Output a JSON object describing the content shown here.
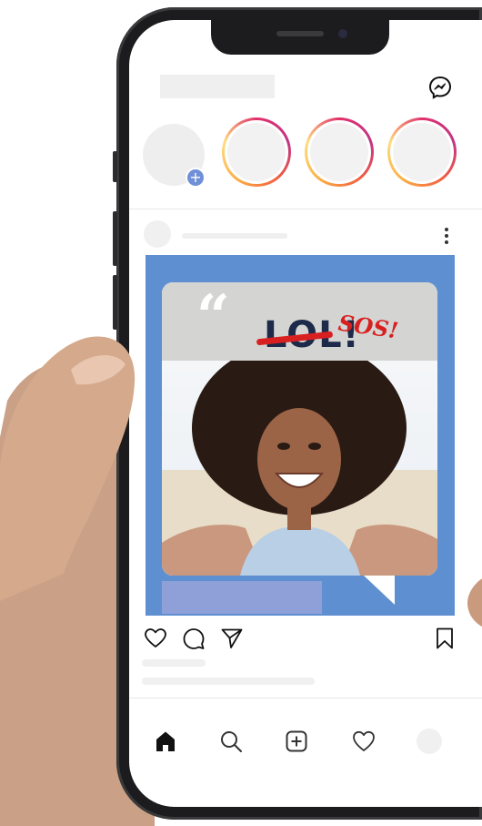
{
  "colors": {
    "post_background": "#5e8fd0",
    "caption_bar": "#8fa0d8",
    "story_add_badge": "#6f8fd8",
    "strike_red": "#d82020",
    "text_navy": "#1e2a4a"
  },
  "header": {
    "messenger_icon": "messenger-icon"
  },
  "stories": {
    "own_story_badge": "+",
    "rings": 3
  },
  "post": {
    "menu_icon": "more-vertical-icon",
    "image": {
      "quote_mark": "“",
      "headline": "LOL!",
      "scribble": "SOS!"
    },
    "actions": [
      "heart-icon",
      "comment-icon",
      "share-icon",
      "bookmark-icon"
    ]
  },
  "tab_bar": {
    "items": [
      "home-icon",
      "search-icon",
      "add-post-icon",
      "activity-heart-icon",
      "profile-avatar"
    ]
  }
}
